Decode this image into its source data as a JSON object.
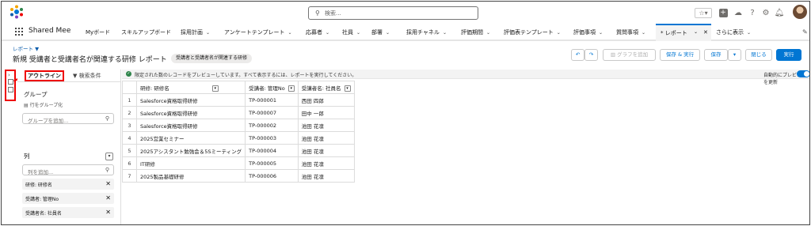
{
  "topbar": {
    "search_placeholder": "検索...",
    "icons": [
      "star-icon",
      "add-icon",
      "trailhead-icon",
      "help-icon",
      "gear-icon",
      "bell-icon"
    ]
  },
  "nav": {
    "app_name": "Shared Mee",
    "items": [
      {
        "label": "Myボード",
        "has_dropdown": false
      },
      {
        "label": "スキルアップボード",
        "has_dropdown": false
      },
      {
        "label": "採用計画",
        "has_dropdown": true
      },
      {
        "label": "アンケートテンプレート",
        "has_dropdown": true
      },
      {
        "label": "応募者",
        "has_dropdown": true
      },
      {
        "label": "社員",
        "has_dropdown": true
      },
      {
        "label": "部署",
        "has_dropdown": true
      },
      {
        "label": "採用チャネル",
        "has_dropdown": true
      },
      {
        "label": "評価期間",
        "has_dropdown": true
      },
      {
        "label": "評価表テンプレート",
        "has_dropdown": true
      },
      {
        "label": "評価事項",
        "has_dropdown": true
      },
      {
        "label": "質問事項",
        "has_dropdown": true
      }
    ],
    "active_tab": "* レポート",
    "more": "さらに表示"
  },
  "report": {
    "breadcrumb": "レポート ▼",
    "title": "新規 受講者と受講者名が関連する研修 レポート",
    "type_badge": "受講者と受講者名が関連する研修",
    "buttons": {
      "add_chart": "グラフを追加",
      "save_run": "保存 & 実行",
      "save": "保存",
      "close": "閉じる",
      "run": "実行"
    }
  },
  "panel": {
    "tab_outline": "アウトライン",
    "tab_filters": "検索条件",
    "group_title": "グループ",
    "group_rows_label": "行をグループ化",
    "group_placeholder": "グループを追加...",
    "columns_title": "列",
    "columns_placeholder": "列を追加...",
    "columns": [
      "研修: 研修名",
      "受講者: 管理No",
      "受講者名: 社員名"
    ]
  },
  "preview": {
    "notice": "限定された数のレコードをプレビューしています。すべて表示するには、レポートを実行してください。",
    "auto_update": "自動的にプレビューを更新",
    "headers": [
      "研修: 研修名",
      "受講者: 管理No",
      "受講者名: 社員名"
    ],
    "rows": [
      {
        "n": "1",
        "name": "Salesforce資格取得研修",
        "no": "TP-000001",
        "emp": "西田 四郎"
      },
      {
        "n": "2",
        "name": "Salesforce資格取得研修",
        "no": "TP-000007",
        "emp": "田中 一郎"
      },
      {
        "n": "3",
        "name": "Salesforce資格取得研修",
        "no": "TP-000002",
        "emp": "池田 花凛"
      },
      {
        "n": "4",
        "name": "2025営業セミナー",
        "no": "TP-000003",
        "emp": "池田 花凛"
      },
      {
        "n": "5",
        "name": "2025アシスタント勉強会＆5Sミーティング",
        "no": "TP-000004",
        "emp": "池田 花凛"
      },
      {
        "n": "6",
        "name": "IT研修",
        "no": "TP-000005",
        "emp": "池田 花凛"
      },
      {
        "n": "7",
        "name": "2025製品基礎研修",
        "no": "TP-000006",
        "emp": "池田 花凛"
      }
    ]
  },
  "colors": {
    "brand": "#0176d3",
    "highlight": "#e00000"
  }
}
